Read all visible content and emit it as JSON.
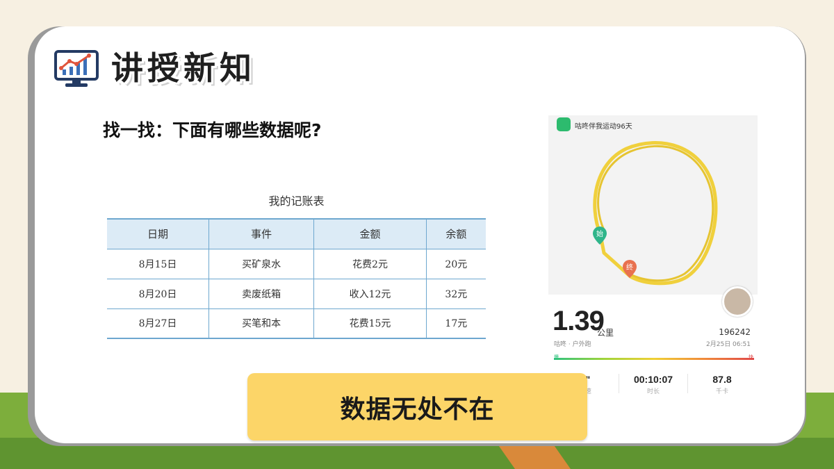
{
  "header": {
    "title": "讲授新知",
    "icon": "chart-monitor-icon"
  },
  "question": "找一找：下面有哪些数据呢?",
  "ledger": {
    "caption": "我的记账表",
    "headers": [
      "日期",
      "事件",
      "金额",
      "余额"
    ],
    "rows": [
      [
        "8月15日",
        "买矿泉水",
        "花费2元",
        "20元"
      ],
      [
        "8月20日",
        "卖废纸箱",
        "收入12元",
        "32元"
      ],
      [
        "8月27日",
        "买笔和本",
        "花费15元",
        "17元"
      ]
    ]
  },
  "run_app": {
    "app_title": "咕咚伴我运动96天",
    "start_marker": "始",
    "end_marker": "终",
    "distance": "1.39",
    "distance_unit": "公里",
    "steps": "196242",
    "sub_label": "咕咚 · 户外跑",
    "date": "2月25日 06:51",
    "speed_slow": "慢",
    "speed_fast": "快",
    "stats": [
      {
        "value": "4\"",
        "label": "配速"
      },
      {
        "value": "00:10:07",
        "label": "时长"
      },
      {
        "value": "87.8",
        "label": "千卡"
      }
    ],
    "colors": {
      "route": "#f0d03c",
      "start": "#2fb58a",
      "end": "#e8714f"
    }
  },
  "callout": "数据无处不在"
}
